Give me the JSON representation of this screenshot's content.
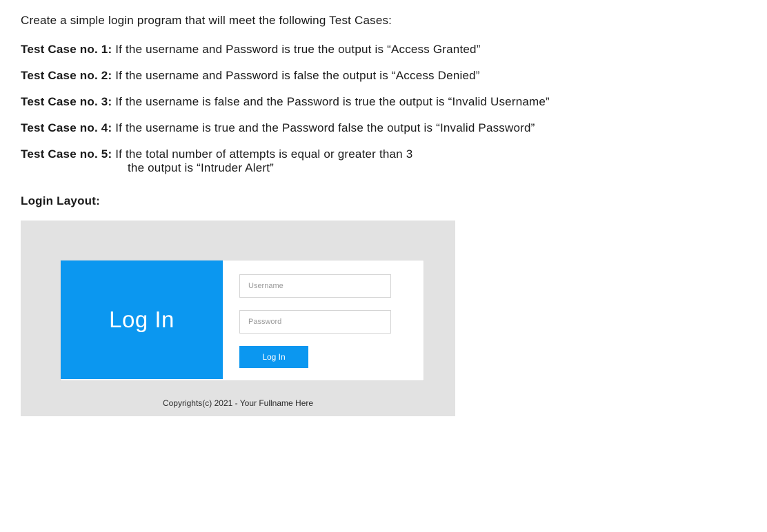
{
  "intro": "Create a simple login program that will meet the following Test Cases:",
  "cases": {
    "c1_label": "Test Case no. 1:",
    "c1_text": " If the username and Password is true the output is “Access Granted”",
    "c2_label": "Test Case no. 2:",
    "c2_text": " If the username and Password is false the output is “Access Denied”",
    "c3_label": "Test Case no. 3:",
    "c3_text": " If the username is false and the Password is true the output is “Invalid Username”",
    "c4_label": "Test Case no. 4:",
    "c4_text": " If the username is true and the Password false the output is “Invalid Password”",
    "c5_label": "Test Case no. 5:",
    "c5_text_line1": " If the total number of attempts is equal or greater than 3",
    "c5_text_line2": "the output is “Intruder Alert”"
  },
  "section_label": "Login Layout:",
  "login": {
    "banner": "Log In",
    "username_placeholder": "Username",
    "password_placeholder": "Password",
    "button": "Log In",
    "copyright": "Copyrights(c) 2021 - Your Fullname Here"
  }
}
